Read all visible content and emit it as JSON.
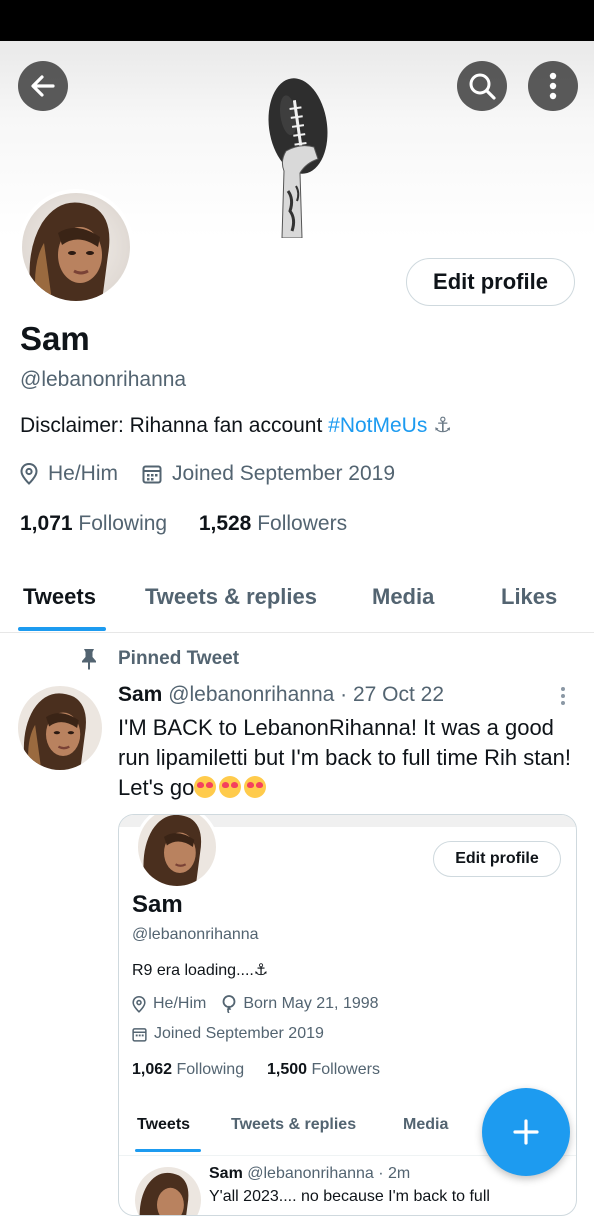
{
  "header": {
    "back_icon": "arrow-left-icon",
    "search_icon": "search-icon",
    "more_icon": "more-vertical-icon"
  },
  "profile": {
    "name": "Sam",
    "handle": "@lebanonrihanna",
    "edit_label": "Edit profile",
    "bio_text": "Disclaimer: Rihanna fan account ",
    "bio_hashtag": "#NotMeUs",
    "bio_anchor": "⚓",
    "pronouns": "He/Him",
    "joined": "Joined September 2019",
    "following_count": "1,071",
    "following_label": "Following",
    "followers_count": "1,528",
    "followers_label": "Followers"
  },
  "tabs": [
    "Tweets",
    "Tweets & replies",
    "Media",
    "Likes"
  ],
  "pinned": {
    "label": "Pinned Tweet",
    "author": "Sam",
    "handle_date": "@lebanonrihanna · 27 Oct 22",
    "text": "I'M BACK to LebanonRihanna! It was a good run lipamiletti but I'm back to full time Rih stan! Let's go"
  },
  "card": {
    "edit_label": "Edit profile",
    "name": "Sam",
    "handle": "@lebanonrihanna",
    "bio": "R9 era loading....⚓",
    "pronouns": "He/Him",
    "born": "Born May 21, 1998",
    "joined": "Joined September 2019",
    "following_count": "1,062",
    "following_label": "Following",
    "followers_count": "1,500",
    "followers_label": "Followers",
    "tabs": [
      "Tweets",
      "Tweets & replies",
      "Media"
    ],
    "tweet_author": "Sam",
    "tweet_handle_time": "@lebanonrihanna · 2m",
    "tweet_text": "Y'all 2023.... no because I'm back to full"
  },
  "colors": {
    "accent": "#1d9bf0",
    "text": "#0f1419",
    "muted": "#536471"
  }
}
